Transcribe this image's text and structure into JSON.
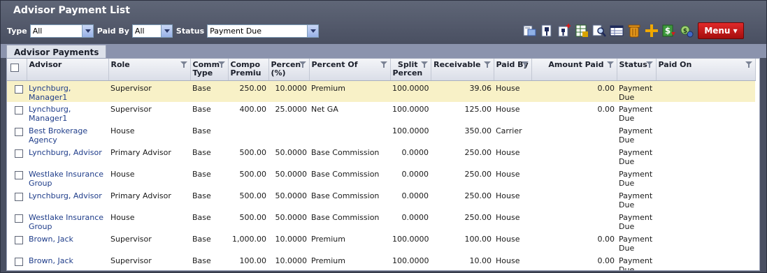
{
  "header": {
    "title": "Advisor Payment List"
  },
  "filters": {
    "type_label": "Type",
    "type_value": "All",
    "paidby_label": "Paid By",
    "paidby_value": "All",
    "status_label": "Status",
    "status_value": "Payment Due"
  },
  "toolbar": {
    "icons": [
      "export-icon",
      "pin-icon",
      "pin-add-icon",
      "excel-icon",
      "search-icon",
      "columns-icon",
      "delete-icon",
      "add-icon",
      "payment-icon",
      "refresh-payment-icon"
    ],
    "menu_label": "Menu ▾"
  },
  "tab": {
    "label": "Advisor Payments"
  },
  "table": {
    "columns": [
      "Advisor",
      "Role",
      "Comm Type",
      "Compo Premiu",
      "Percen (%)",
      "Percent Of",
      "Split Percen",
      "Receivable",
      "Paid By",
      "Amount Paid",
      "Status",
      "Paid On"
    ],
    "rows": [
      {
        "advisor": "Lynchburg, Manager1",
        "role": "Supervisor",
        "comm_type": "Base",
        "premium": "250.00",
        "percent": "10.0000",
        "percent_of": "Premium",
        "split": "100.0000",
        "receivable": "39.06",
        "paid_by": "House",
        "amount_paid": "0.00",
        "status": "Payment Due",
        "paid_on": ""
      },
      {
        "advisor": "Lynchburg, Manager1",
        "role": "Supervisor",
        "comm_type": "Base",
        "premium": "400.00",
        "percent": "25.0000",
        "percent_of": "Net GA",
        "split": "100.0000",
        "receivable": "125.00",
        "paid_by": "House",
        "amount_paid": "0.00",
        "status": "Payment Due",
        "paid_on": ""
      },
      {
        "advisor": "Best Brokerage Agency",
        "role": "House",
        "comm_type": "Base",
        "premium": "",
        "percent": "",
        "percent_of": "",
        "split": "100.0000",
        "receivable": "350.00",
        "paid_by": "Carrier",
        "amount_paid": "",
        "status": "Payment Due",
        "paid_on": ""
      },
      {
        "advisor": "Lynchburg, Advisor",
        "role": "Primary Advisor",
        "comm_type": "Base",
        "premium": "500.00",
        "percent": "50.0000",
        "percent_of": "Base Commission",
        "split": "0.0000",
        "receivable": "250.00",
        "paid_by": "House",
        "amount_paid": "",
        "status": "Payment Due",
        "paid_on": ""
      },
      {
        "advisor": "Westlake Insurance Group",
        "role": "House",
        "comm_type": "Base",
        "premium": "500.00",
        "percent": "50.0000",
        "percent_of": "Base Commission",
        "split": "0.0000",
        "receivable": "250.00",
        "paid_by": "House",
        "amount_paid": "",
        "status": "Payment Due",
        "paid_on": ""
      },
      {
        "advisor": "Lynchburg, Advisor",
        "role": "Primary Advisor",
        "comm_type": "Base",
        "premium": "500.00",
        "percent": "50.0000",
        "percent_of": "Base Commission",
        "split": "0.0000",
        "receivable": "250.00",
        "paid_by": "House",
        "amount_paid": "",
        "status": "Payment Due",
        "paid_on": ""
      },
      {
        "advisor": "Westlake Insurance Group",
        "role": "House",
        "comm_type": "Base",
        "premium": "500.00",
        "percent": "50.0000",
        "percent_of": "Base Commission",
        "split": "0.0000",
        "receivable": "250.00",
        "paid_by": "House",
        "amount_paid": "",
        "status": "Payment Due",
        "paid_on": ""
      },
      {
        "advisor": "Brown, Jack",
        "role": "Supervisor",
        "comm_type": "Base",
        "premium": "1,000.00",
        "percent": "10.0000",
        "percent_of": "Premium",
        "split": "100.0000",
        "receivable": "100.00",
        "paid_by": "House",
        "amount_paid": "0.00",
        "status": "Payment Due",
        "paid_on": ""
      },
      {
        "advisor": "Brown, Jack",
        "role": "Supervisor",
        "comm_type": "Base",
        "premium": "100.00",
        "percent": "10.0000",
        "percent_of": "Premium",
        "split": "100.0000",
        "receivable": "10.00",
        "paid_by": "House",
        "amount_paid": "0.00",
        "status": "Payment Due",
        "paid_on": ""
      }
    ]
  }
}
